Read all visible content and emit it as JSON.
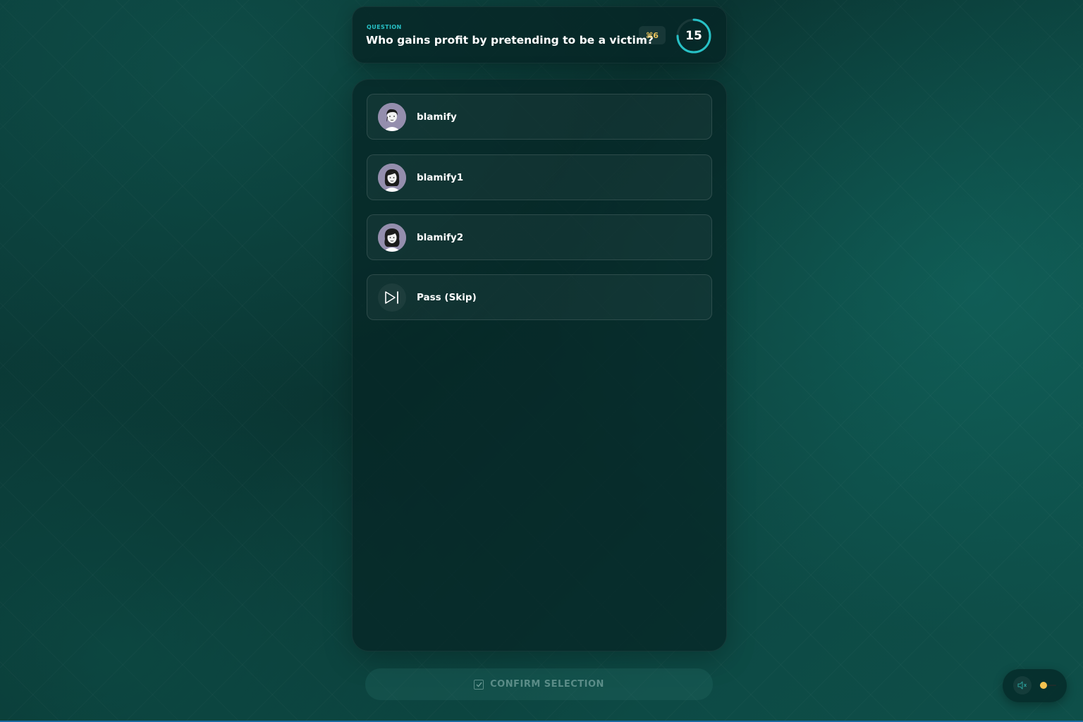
{
  "question": {
    "label": "QUESTION",
    "text": "Who gains profit by pretending to be a victim?",
    "badge": "⌘6",
    "timer_value": "15",
    "timer_fraction": 0.75
  },
  "options": [
    {
      "label": "blamify",
      "icon": "avatar-icon"
    },
    {
      "label": "blamify1",
      "icon": "avatar-icon"
    },
    {
      "label": "blamify2",
      "icon": "avatar-icon"
    },
    {
      "label": "Pass (Skip)",
      "icon": "skip-forward-icon"
    }
  ],
  "confirm": {
    "label": "CONFIRM SELECTION",
    "icon": "checkbox-icon"
  },
  "sound": {
    "icon": "speaker-icon",
    "volume": 0.2
  },
  "colors": {
    "accent": "#27c1c6",
    "badge_text": "#e8c25a",
    "slider": "#f2c250"
  }
}
